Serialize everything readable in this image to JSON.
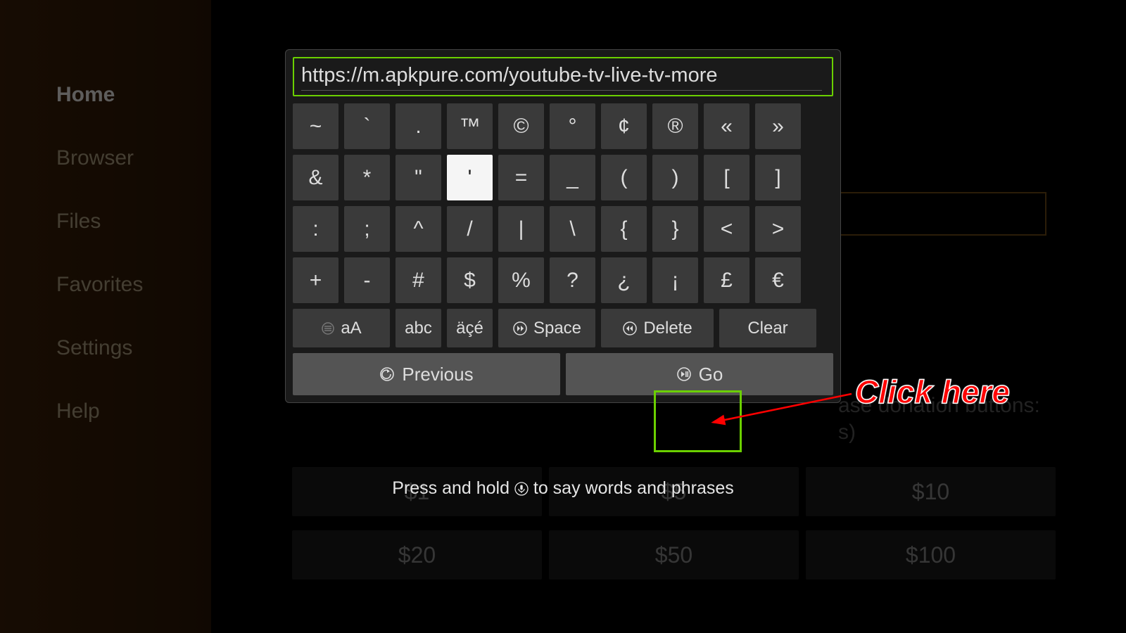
{
  "sidebar": {
    "items": [
      {
        "label": "Home",
        "selected": true
      },
      {
        "label": "Browser"
      },
      {
        "label": "Files"
      },
      {
        "label": "Favorites"
      },
      {
        "label": "Settings"
      },
      {
        "label": "Help"
      }
    ]
  },
  "background": {
    "donation_hint": "ase donation buttons:",
    "donation_hint2": "s)",
    "row1": [
      "$1",
      "$5",
      "$10"
    ],
    "row2": [
      "$20",
      "$50",
      "$100"
    ]
  },
  "keyboard": {
    "url": "https://m.apkpure.com/youtube-tv-live-tv-more",
    "rows": [
      [
        "~",
        "`",
        ".",
        "™",
        "©",
        "°",
        "¢",
        "®",
        "«",
        "»"
      ],
      [
        "&",
        "*",
        "\"",
        "'",
        "=",
        "_",
        "(",
        ")",
        "[",
        "]"
      ],
      [
        ":",
        ";",
        "^",
        "/",
        "|",
        "\\",
        "{",
        "}",
        "<",
        ">"
      ],
      [
        "+",
        "-",
        "#",
        "$",
        "%",
        "?",
        "¿",
        "¡",
        "£",
        "€"
      ]
    ],
    "row2_gap_index": 5,
    "selected_key": "'",
    "func": {
      "shift": "aA",
      "abc": "abc",
      "accents": "äçé",
      "space": "Space",
      "delete": "Delete",
      "clear": "Clear"
    },
    "nav": {
      "previous": "Previous",
      "go": "Go"
    },
    "hint_prefix": "Press and hold ",
    "hint_suffix": " to say words and phrases"
  },
  "annotation": {
    "label": "Click here"
  }
}
